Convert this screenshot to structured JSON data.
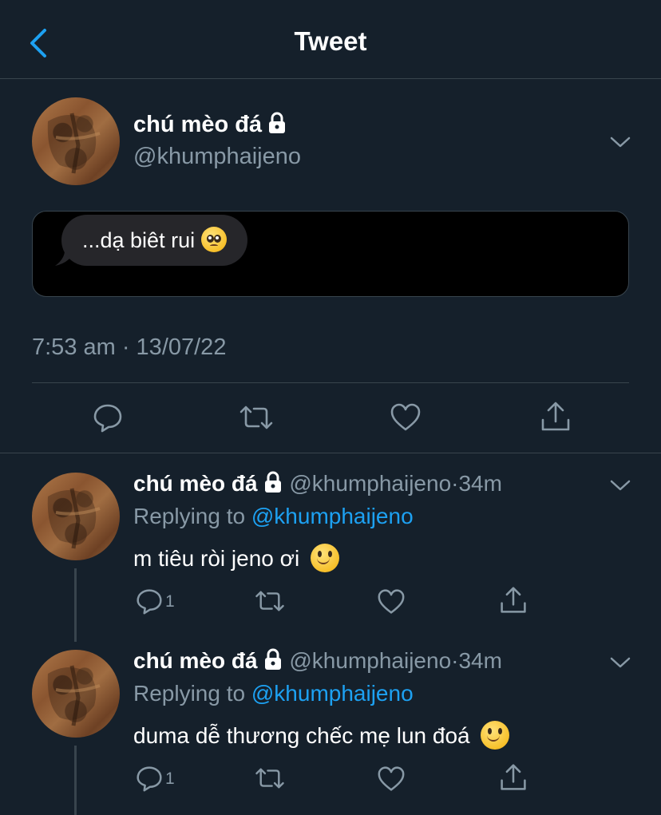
{
  "header": {
    "title": "Tweet"
  },
  "tweet": {
    "author_name": "chú mèo đá",
    "handle": "@khumphaijeno",
    "message_text": "...dạ biêt rui",
    "message_emoji": "pleading-face",
    "timestamp": "7:53 am · 13/07/22"
  },
  "replies": [
    {
      "author_name": "chú mèo đá",
      "handle": "@khumphaijeno",
      "separator": "·",
      "time": "34m",
      "replying_prefix": "Replying to",
      "replying_to": "@khumphaijeno",
      "text": "m tiêu ròi jeno ơi",
      "emoji": "slightly-smiling-face",
      "reply_count": "1"
    },
    {
      "author_name": "chú mèo đá",
      "handle": "@khumphaijeno",
      "separator": "·",
      "time": "34m",
      "replying_prefix": "Replying to",
      "replying_to": "@khumphaijeno",
      "text": "duma dễ thương chếc mẹ lun đoá",
      "emoji": "slightly-smiling-face",
      "reply_count": "1"
    }
  ],
  "icons": {
    "back": "chevron-left-icon",
    "lock": "lock-icon",
    "more": "chevron-down-icon",
    "reply": "comment-icon",
    "retweet": "retweet-icon",
    "like": "heart-icon",
    "share": "share-icon"
  },
  "colors": {
    "background": "#15202b",
    "accent": "#1da1f2",
    "secondary_text": "#8899a6",
    "divider": "#38444d"
  }
}
